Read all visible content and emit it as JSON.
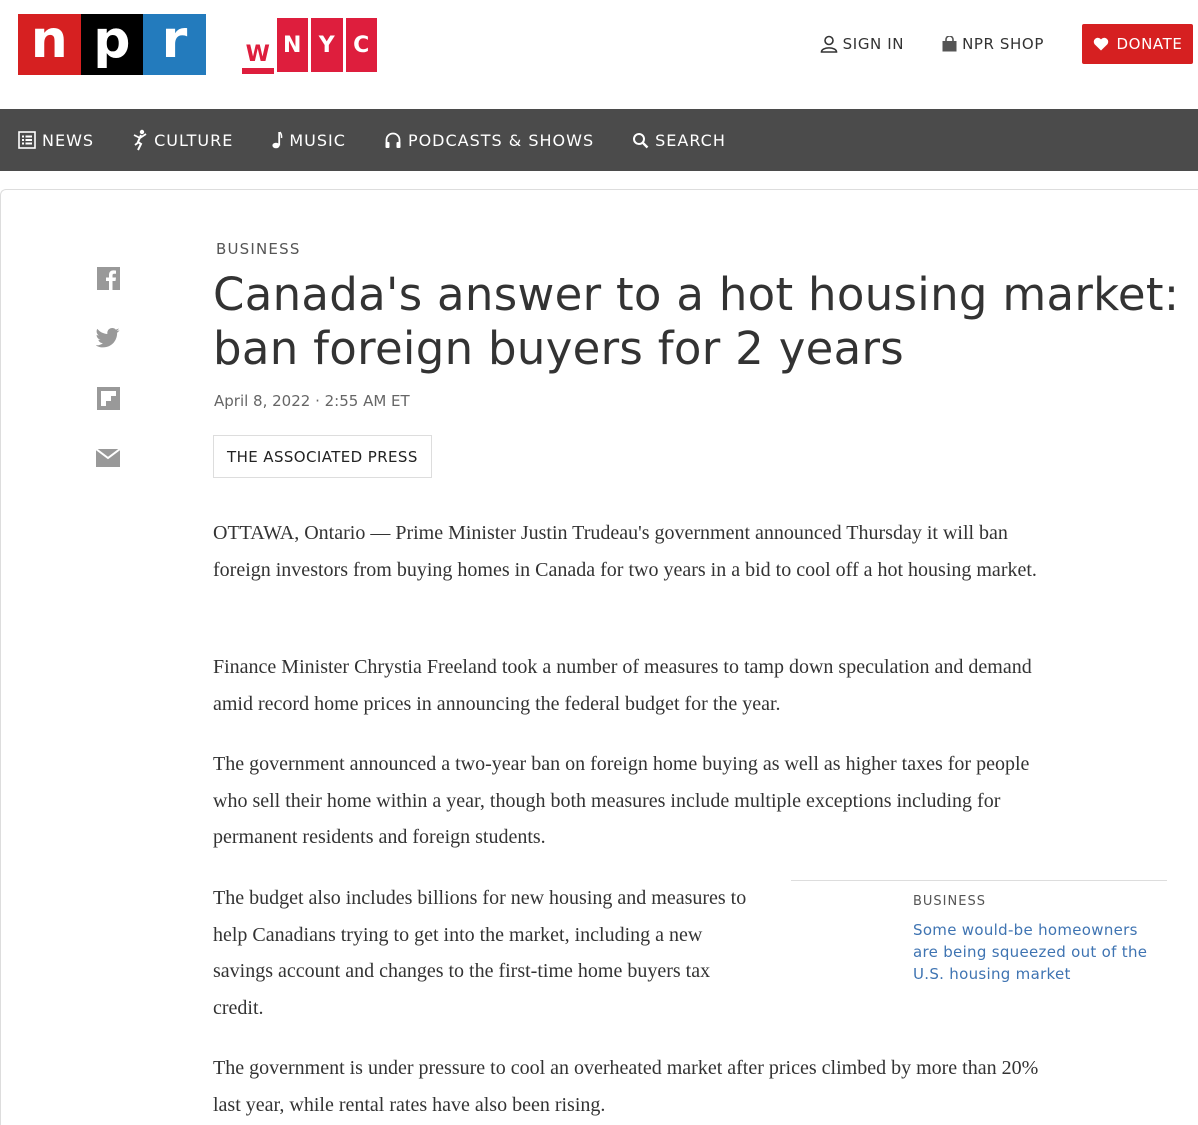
{
  "header": {
    "npr_logo_letters": [
      "n",
      "p",
      "r"
    ],
    "wnyc_logo_letters": [
      "W",
      "N",
      "Y",
      "C"
    ],
    "sign_in_label": "SIGN IN",
    "shop_label": "NPR SHOP",
    "donate_label": "DONATE",
    "colors": {
      "npr_red": "#d62021",
      "npr_black": "#000000",
      "npr_blue": "#237bbd",
      "wnyc_red": "#de1e3d",
      "donate_red": "#d62021"
    }
  },
  "nav": {
    "items": [
      {
        "label": "NEWS",
        "icon": "news-icon"
      },
      {
        "label": "CULTURE",
        "icon": "culture-icon"
      },
      {
        "label": "MUSIC",
        "icon": "music-note-icon"
      },
      {
        "label": "PODCASTS & SHOWS",
        "icon": "headphones-icon"
      },
      {
        "label": "SEARCH",
        "icon": "search-icon"
      }
    ],
    "background": "#4b4b4b"
  },
  "share": {
    "icons": [
      "facebook-icon",
      "twitter-icon",
      "flipboard-icon",
      "email-icon"
    ]
  },
  "article": {
    "slug": "BUSINESS",
    "title": "Canada's answer to a hot housing market: ban foreign buyers for 2 years",
    "date": "April 8, 2022 · 2:55 AM ET",
    "byline": "THE ASSOCIATED PRESS",
    "paragraphs": [
      "OTTAWA, Ontario — Prime Minister Justin Trudeau's government announced Thursday it will ban foreign investors from buying homes in Canada for two years in a bid to cool off a hot housing market.",
      "Finance Minister Chrystia Freeland took a number of measures to tamp down speculation and demand amid record home prices in announcing the federal budget for the year.",
      "The government announced a two-year ban on foreign home buying as well as higher taxes for people who sell their home within a year, though both measures include multiple exceptions including for permanent residents and foreign students.",
      "The budget also includes billions for new housing and measures to help Canadians trying to get into the market, including a new savings account and changes to the first-time home buyers tax credit.",
      "The government is under pressure to cool an overheated market after prices climbed by more than 20% last year, while rental rates have also been rising."
    ]
  },
  "related": {
    "slug": "BUSINESS",
    "link": "Some would-be homeowners are being squeezed out of the U.S. housing market",
    "link_color": "#3f74b2"
  }
}
